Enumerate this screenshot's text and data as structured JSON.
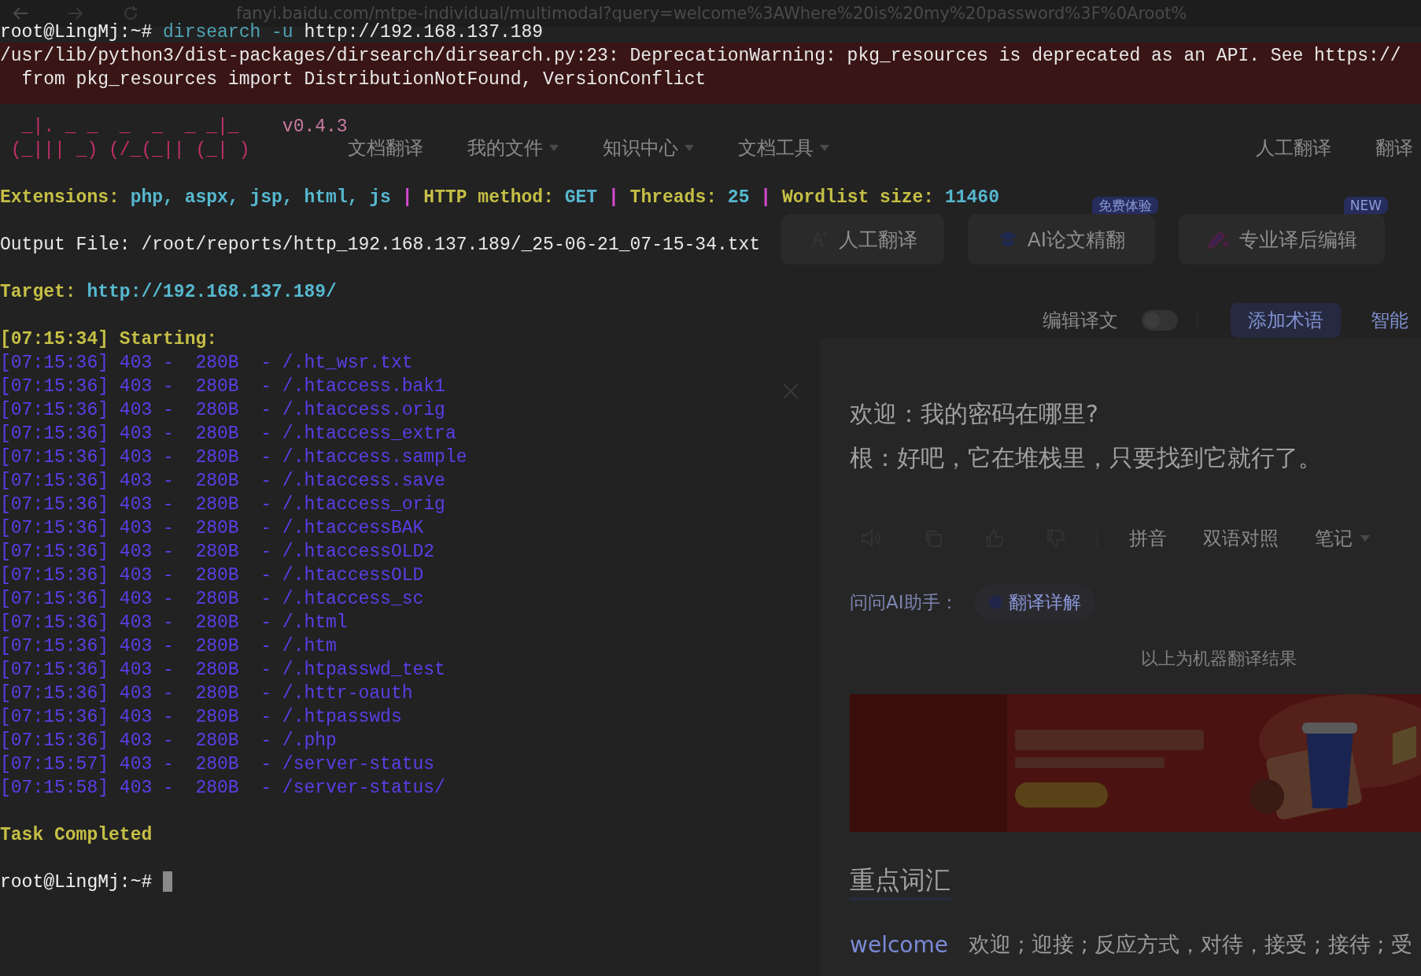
{
  "browser": {
    "address": "fanyi.baidu.com/mtpe-individual/multimodal?query=welcome%3AWhere%20is%20my%20password%3F%0Aroot%"
  },
  "nav": {
    "items": [
      {
        "label": "文档翻译",
        "dropdown": false
      },
      {
        "label": "我的文件",
        "dropdown": true
      },
      {
        "label": "知识中心",
        "dropdown": true
      },
      {
        "label": "文档工具",
        "dropdown": true
      }
    ],
    "right": [
      {
        "label": "人工翻译"
      },
      {
        "label": "翻译"
      }
    ]
  },
  "tools": [
    {
      "label": "人工翻译",
      "kind": "ai"
    },
    {
      "label": "AI论文精翻",
      "kind": "cap",
      "badge": "免费体验"
    },
    {
      "label": "专业译后编辑",
      "kind": "pen",
      "badge": "NEW"
    }
  ],
  "options": {
    "edit_label": "编辑译文",
    "edit_on": false,
    "term_button": "添加术语",
    "smart": "智能"
  },
  "translation": {
    "lines": [
      "欢迎：我的密码在哪里?",
      "根：好吧，它在堆栈里，只要找到它就行了。"
    ],
    "actions": [
      {
        "label": "拼音",
        "dropdown": false
      },
      {
        "label": "双语对照",
        "dropdown": false
      },
      {
        "label": "笔记",
        "dropdown": true
      }
    ],
    "ai_label": "问问AI助手：",
    "ai_button": "翻译详解",
    "notice": "以上为机器翻译结果"
  },
  "vocabulary": {
    "title": "重点词汇",
    "entries": [
      {
        "word": "welcome",
        "meaning": "欢迎 ; 迎接 ; 反应方式，对待，接受 ; 接待 ; 受"
      }
    ]
  },
  "terminal": {
    "lines": [
      {
        "kind": "text",
        "segments": [
          {
            "kind": "prompt",
            "text": "root@LingMj:~# "
          },
          {
            "kind": "command",
            "text": "dirsearch -u"
          },
          {
            "kind": "text",
            "text": " http://192.168.137.189"
          }
        ]
      },
      {
        "kind": "text",
        "segments": [
          {
            "kind": "text",
            "text": "/usr/lib/python3/dist-packages/dirsearch/dirsearch.py:23: DeprecationWarning: pkg_resources is deprecated as an API. See https://"
          }
        ]
      },
      {
        "kind": "text",
        "segments": [
          {
            "kind": "text",
            "text": "  from pkg_resources import DistributionNotFound, VersionConflict"
          }
        ]
      },
      {
        "kind": "blank"
      },
      {
        "kind": "text",
        "segments": [
          {
            "kind": "banner",
            "text": "  _|. _ _  _  _  _ _|_    "
          },
          {
            "kind": "version",
            "text": "v0.4.3"
          }
        ]
      },
      {
        "kind": "text",
        "segments": [
          {
            "kind": "banner",
            "text": " (_||| _) (/_(_|| (_| )"
          }
        ]
      },
      {
        "kind": "blank"
      },
      {
        "kind": "text",
        "segments": [
          {
            "kind": "label",
            "text": "Extensions: "
          },
          {
            "kind": "value",
            "text": "php, aspx, jsp, html, js"
          },
          {
            "kind": "sep",
            "text": " | "
          },
          {
            "kind": "label",
            "text": "HTTP method: "
          },
          {
            "kind": "value",
            "text": "GET"
          },
          {
            "kind": "sep",
            "text": " | "
          },
          {
            "kind": "label",
            "text": "Threads: "
          },
          {
            "kind": "value",
            "text": "25"
          },
          {
            "kind": "sep",
            "text": " | "
          },
          {
            "kind": "label",
            "text": "Wordlist size: "
          },
          {
            "kind": "value",
            "text": "11460"
          }
        ]
      },
      {
        "kind": "blank"
      },
      {
        "kind": "text",
        "segments": [
          {
            "kind": "text",
            "text": "Output File: /root/reports/http_192.168.137.189/_25-06-21_07-15-34.txt"
          }
        ]
      },
      {
        "kind": "blank"
      },
      {
        "kind": "text",
        "segments": [
          {
            "kind": "label",
            "text": "Target: "
          },
          {
            "kind": "value",
            "text": "http://192.168.137.189/"
          }
        ]
      },
      {
        "kind": "blank"
      },
      {
        "kind": "text",
        "segments": [
          {
            "kind": "label",
            "text": "[07:15:34] Starting: "
          }
        ]
      },
      {
        "kind": "text",
        "segments": [
          {
            "kind": "entry",
            "text": "[07:15:36] 403 -  280B  - /.ht_wsr.txt"
          }
        ]
      },
      {
        "kind": "text",
        "segments": [
          {
            "kind": "entry",
            "text": "[07:15:36] 403 -  280B  - /.htaccess.bak1"
          }
        ]
      },
      {
        "kind": "text",
        "segments": [
          {
            "kind": "entry",
            "text": "[07:15:36] 403 -  280B  - /.htaccess.orig"
          }
        ]
      },
      {
        "kind": "text",
        "segments": [
          {
            "kind": "entry",
            "text": "[07:15:36] 403 -  280B  - /.htaccess_extra"
          }
        ]
      },
      {
        "kind": "text",
        "segments": [
          {
            "kind": "entry",
            "text": "[07:15:36] 403 -  280B  - /.htaccess.sample"
          }
        ]
      },
      {
        "kind": "text",
        "segments": [
          {
            "kind": "entry",
            "text": "[07:15:36] 403 -  280B  - /.htaccess.save"
          }
        ]
      },
      {
        "kind": "text",
        "segments": [
          {
            "kind": "entry",
            "text": "[07:15:36] 403 -  280B  - /.htaccess_orig"
          }
        ]
      },
      {
        "kind": "text",
        "segments": [
          {
            "kind": "entry",
            "text": "[07:15:36] 403 -  280B  - /.htaccessBAK"
          }
        ]
      },
      {
        "kind": "text",
        "segments": [
          {
            "kind": "entry",
            "text": "[07:15:36] 403 -  280B  - /.htaccessOLD2"
          }
        ]
      },
      {
        "kind": "text",
        "segments": [
          {
            "kind": "entry",
            "text": "[07:15:36] 403 -  280B  - /.htaccessOLD"
          }
        ]
      },
      {
        "kind": "text",
        "segments": [
          {
            "kind": "entry",
            "text": "[07:15:36] 403 -  280B  - /.htaccess_sc"
          }
        ]
      },
      {
        "kind": "text",
        "segments": [
          {
            "kind": "entry",
            "text": "[07:15:36] 403 -  280B  - /.html"
          }
        ]
      },
      {
        "kind": "text",
        "segments": [
          {
            "kind": "entry",
            "text": "[07:15:36] 403 -  280B  - /.htm"
          }
        ]
      },
      {
        "kind": "text",
        "segments": [
          {
            "kind": "entry",
            "text": "[07:15:36] 403 -  280B  - /.htpasswd_test"
          }
        ]
      },
      {
        "kind": "text",
        "segments": [
          {
            "kind": "entry",
            "text": "[07:15:36] 403 -  280B  - /.httr-oauth"
          }
        ]
      },
      {
        "kind": "text",
        "segments": [
          {
            "kind": "entry",
            "text": "[07:15:36] 403 -  280B  - /.htpasswds"
          }
        ]
      },
      {
        "kind": "text",
        "segments": [
          {
            "kind": "entry",
            "text": "[07:15:36] 403 -  280B  - /.php"
          }
        ]
      },
      {
        "kind": "text",
        "segments": [
          {
            "kind": "entry",
            "text": "[07:15:57] 403 -  280B  - /server-status"
          }
        ]
      },
      {
        "kind": "text",
        "segments": [
          {
            "kind": "entry",
            "text": "[07:15:58] 403 -  280B  - /server-status/"
          }
        ]
      },
      {
        "kind": "blank"
      },
      {
        "kind": "text",
        "segments": [
          {
            "kind": "label",
            "text": "Task Completed"
          }
        ]
      },
      {
        "kind": "blank"
      },
      {
        "kind": "text",
        "segments": [
          {
            "kind": "prompt",
            "text": "root@LingMj:~# "
          }
        ],
        "cursor": true
      }
    ]
  }
}
